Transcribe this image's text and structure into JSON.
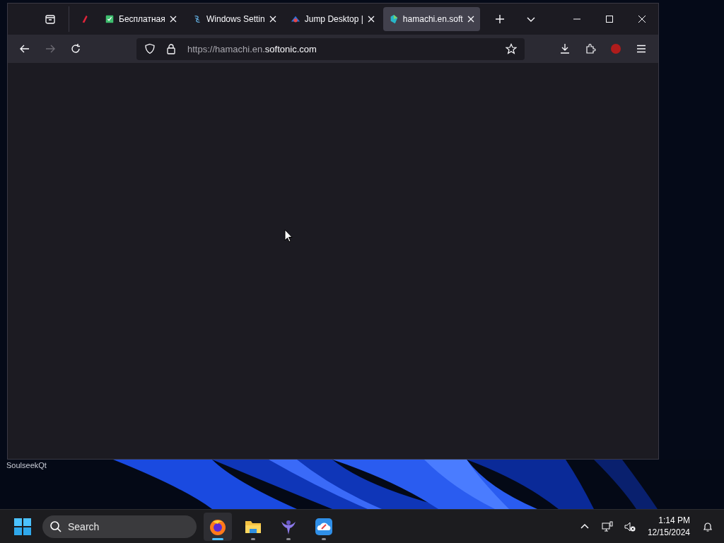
{
  "browser": {
    "tabs": [
      {
        "kind": "pinned",
        "selected": false
      },
      {
        "kind": "tab",
        "title": "Бесплатная",
        "selected": false
      },
      {
        "kind": "tab",
        "title": "Windows Settin",
        "selected": false
      },
      {
        "kind": "tab",
        "title": "Jump Desktop |",
        "selected": false
      },
      {
        "kind": "tab",
        "title": "hamachi.en.soft",
        "selected": true
      }
    ],
    "toolbar": {
      "forward_disabled": true
    },
    "address": {
      "prefix": "https://hamachi.en.",
      "domain": "softonic.com"
    }
  },
  "desktop": {
    "icon_label": "SoulseekQt"
  },
  "taskbar": {
    "search": {
      "placeholder": "Search"
    },
    "apps": [
      {
        "kind": "firefox",
        "active": true
      },
      {
        "kind": "folder",
        "active": false
      },
      {
        "kind": "bird",
        "active": false
      },
      {
        "kind": "cloud",
        "active": false
      }
    ],
    "clock": {
      "time": "1:14 PM",
      "date": "12/15/2024"
    }
  }
}
